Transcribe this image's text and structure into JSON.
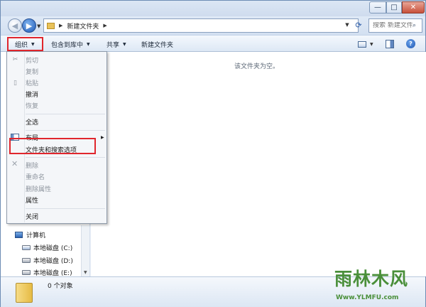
{
  "window": {
    "controls": {
      "minimize": "—",
      "maximize": "□",
      "close": "✕"
    }
  },
  "nav": {
    "back_glyph": "◀",
    "forward_glyph": "▶",
    "breadcrumb": [
      "新建文件夹"
    ],
    "search_placeholder": "搜索 新建文件夹",
    "search_icon": "magnifier-icon"
  },
  "toolbar": {
    "organize": "组织",
    "include_in_library": "包含到库中",
    "share": "共享",
    "new_folder": "新建文件夹",
    "help": "?"
  },
  "content": {
    "empty_message": "该文件夹为空。"
  },
  "navpane": {
    "computer": "计算机",
    "drives": [
      {
        "label": "本地磁盘 (C:)"
      },
      {
        "label": "本地磁盘 (D:)"
      },
      {
        "label": "本地磁盘 (E:)"
      }
    ]
  },
  "details": {
    "count": "0 个对象"
  },
  "menu": {
    "items": [
      {
        "label": "剪切",
        "enabled": false
      },
      {
        "label": "复制",
        "enabled": false
      },
      {
        "label": "粘贴",
        "enabled": false
      },
      {
        "label": "撤消",
        "enabled": true
      },
      {
        "label": "恢复",
        "enabled": false
      },
      {
        "label": "全选",
        "enabled": true
      },
      {
        "label": "布局",
        "enabled": true
      },
      {
        "label": "文件夹和搜索选项",
        "enabled": true
      },
      {
        "label": "删除",
        "enabled": false
      },
      {
        "label": "重命名",
        "enabled": false
      },
      {
        "label": "删除属性",
        "enabled": false
      },
      {
        "label": "属性",
        "enabled": true
      },
      {
        "label": "关闭",
        "enabled": true
      }
    ]
  },
  "watermark": {
    "brand": "雨林木风",
    "url": "Www.YLMFU.com"
  },
  "colors": {
    "highlight_border": "#e0262d",
    "accent": "#1d59b8"
  }
}
